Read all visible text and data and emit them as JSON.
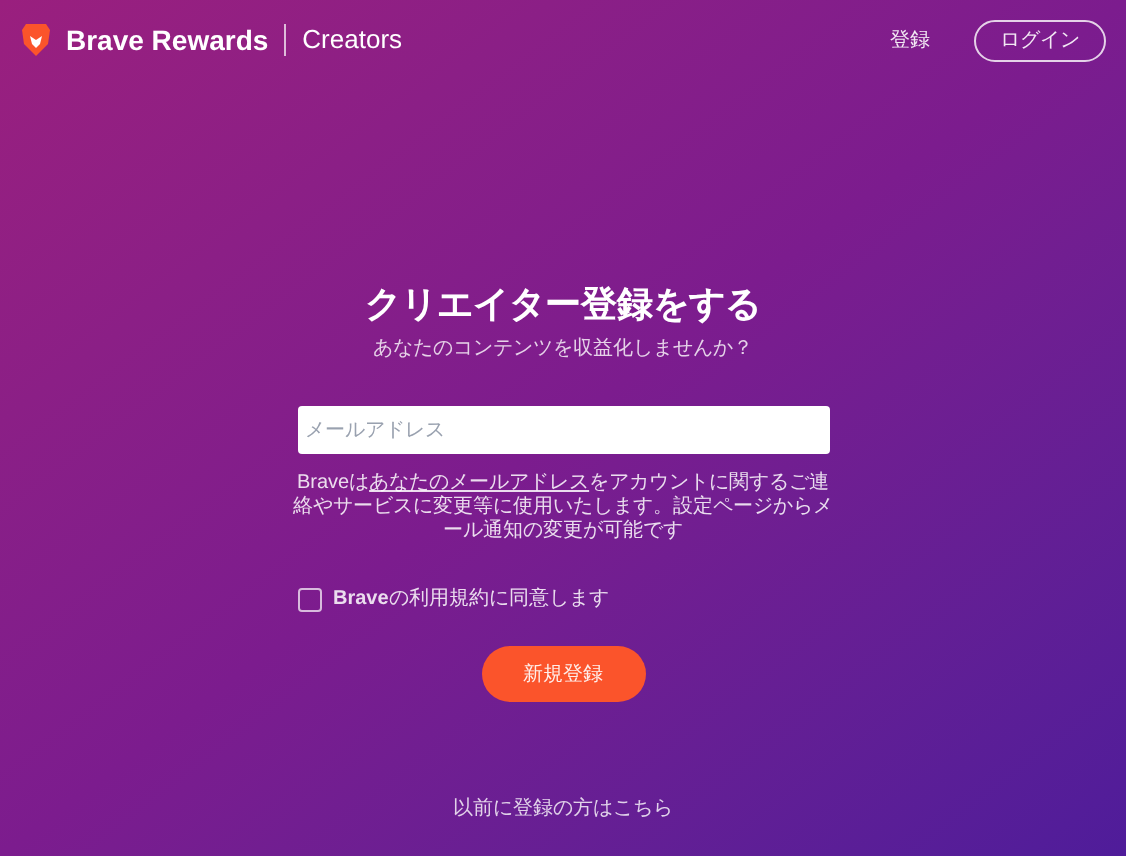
{
  "header": {
    "brand": "Brave Rewards",
    "section": "Creators",
    "nav": [
      {
        "kind": "link",
        "label": "登録"
      },
      {
        "kind": "outline",
        "label": "ログイン"
      }
    ]
  },
  "signup": {
    "title": "クリエイター登録をする",
    "subtitle": "あなたのコンテンツを収益化しませんか？",
    "email": {
      "placeholder": "メールアドレス"
    },
    "notice": {
      "before": "Braveは",
      "link": "あなたのメールアドレス",
      "after": "をアカウントに関するご連絡やサービスに変更等に使用いたします。設定ページからメール通知の変更が可能です"
    },
    "terms": {
      "label": "**Brave**の利用規約に同意します",
      "checked": false
    },
    "submit": "新規登録",
    "login_link": "以前に登録の方はこちら"
  }
}
